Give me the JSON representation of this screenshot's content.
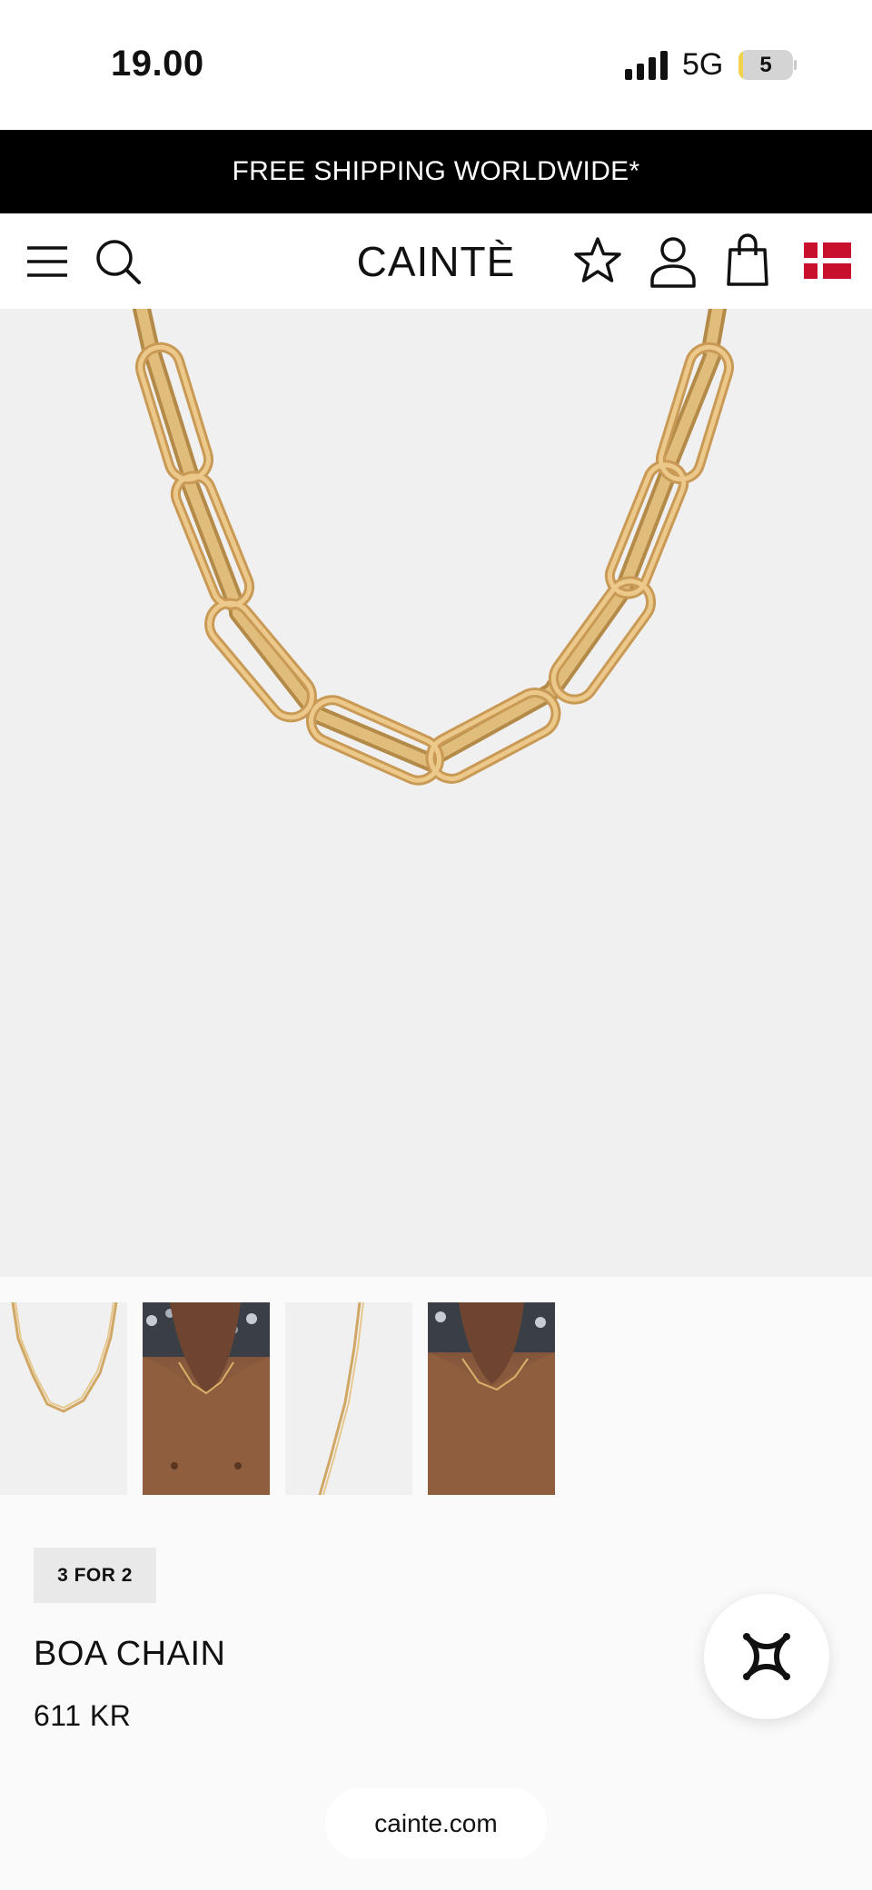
{
  "status_bar": {
    "time": "19.00",
    "network": "5G",
    "battery_level": "5",
    "battery_fraction": 0.05
  },
  "announcement": {
    "text": "FREE SHIPPING WORLDWIDE*"
  },
  "header": {
    "logo": "CAINTÈ",
    "icons": [
      "menu-icon",
      "search-icon",
      "star-icon",
      "account-icon",
      "bag-icon",
      "denmark-flag-icon"
    ],
    "flag_color": "#c8102e"
  },
  "hero": {
    "background": "#f1f0f0",
    "chain_color": "#d9b06a"
  },
  "thumbnails": {
    "count": 4,
    "active_index": 0
  },
  "product": {
    "badge": "3 FOR 2",
    "name": "BOA CHAIN",
    "price": "611 KR"
  },
  "browser": {
    "url": "cainte.com"
  }
}
